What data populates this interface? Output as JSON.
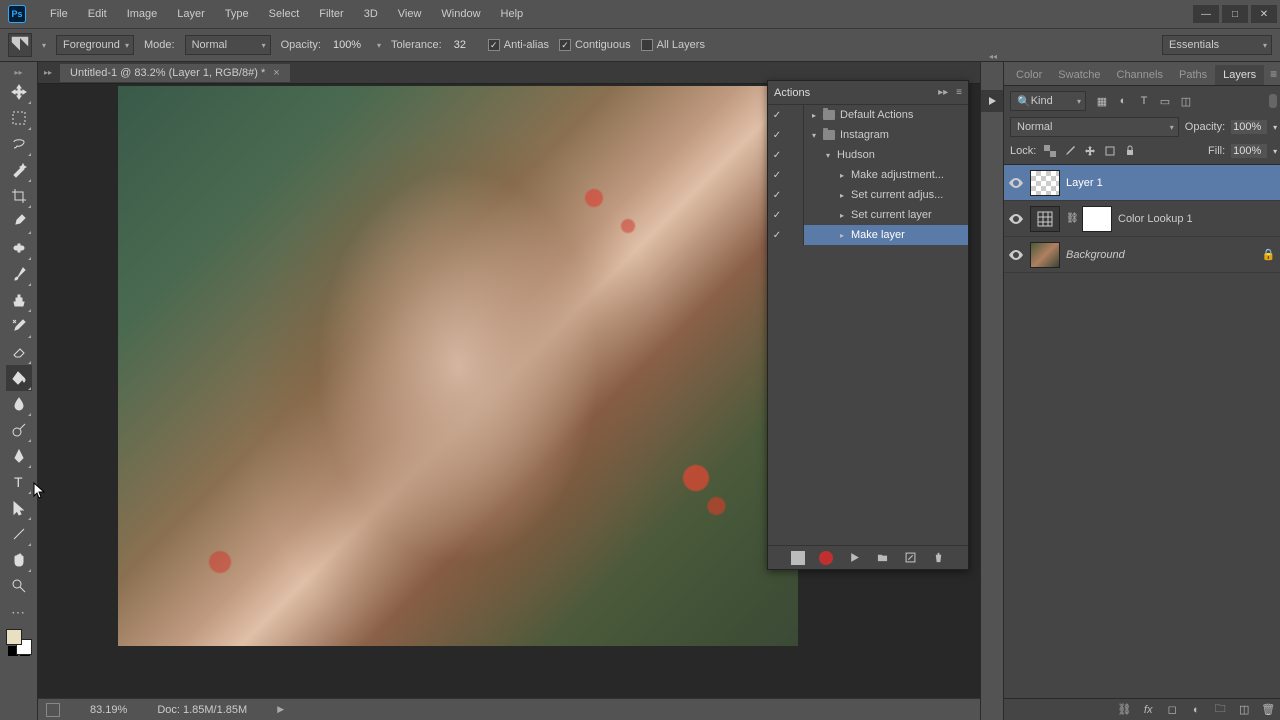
{
  "app": {
    "logo_text": "Ps"
  },
  "menu": [
    "File",
    "Edit",
    "Image",
    "Layer",
    "Type",
    "Select",
    "Filter",
    "3D",
    "View",
    "Window",
    "Help"
  ],
  "win_controls": [
    "—",
    "□",
    "✕"
  ],
  "options_bar": {
    "fill_dd": "Foreground",
    "mode_label": "Mode:",
    "mode_value": "Normal",
    "opacity_label": "Opacity:",
    "opacity_value": "100%",
    "tolerance_label": "Tolerance:",
    "tolerance_value": "32",
    "antialias": "Anti-alias",
    "contiguous": "Contiguous",
    "all_layers": "All Layers",
    "workspace": "Essentials"
  },
  "document_tab": "Untitled-1 @ 83.2% (Layer 1, RGB/8#) *",
  "status": {
    "zoom": "83.19%",
    "doc": "Doc: 1.85M/1.85M"
  },
  "actions_panel": {
    "title": "Actions",
    "items": [
      {
        "check": "✓",
        "indent": 0,
        "disclosure": "▸",
        "folder": true,
        "label": "Default Actions"
      },
      {
        "check": "✓",
        "indent": 0,
        "disclosure": "▾",
        "folder": true,
        "label": "Instagram"
      },
      {
        "check": "✓",
        "indent": 1,
        "disclosure": "▾",
        "folder": false,
        "label": "Hudson"
      },
      {
        "check": "✓",
        "indent": 2,
        "disclosure": "▸",
        "folder": false,
        "label": "Make adjustment..."
      },
      {
        "check": "✓",
        "indent": 2,
        "disclosure": "▸",
        "folder": false,
        "label": "Set current adjus..."
      },
      {
        "check": "✓",
        "indent": 2,
        "disclosure": "▸",
        "folder": false,
        "label": "Set current layer"
      },
      {
        "check": "✓",
        "indent": 2,
        "disclosure": "▸",
        "folder": false,
        "label": "Make layer",
        "selected": true
      }
    ]
  },
  "right_tabs": [
    "Color",
    "Swatche",
    "Channels",
    "Paths",
    "Layers"
  ],
  "layers_panel": {
    "kind": "Kind",
    "blend": "Normal",
    "opacity_label": "Opacity:",
    "opacity_value": "100%",
    "lock_label": "Lock:",
    "fill_label": "Fill:",
    "fill_value": "100%",
    "layers": [
      {
        "name": "Layer 1",
        "thumb": "checker",
        "selected": true
      },
      {
        "name": "Color Lookup 1",
        "thumb": "lut",
        "link": true,
        "mask": true
      },
      {
        "name": "Background",
        "thumb": "bg",
        "italic": true,
        "locked": true
      }
    ]
  }
}
